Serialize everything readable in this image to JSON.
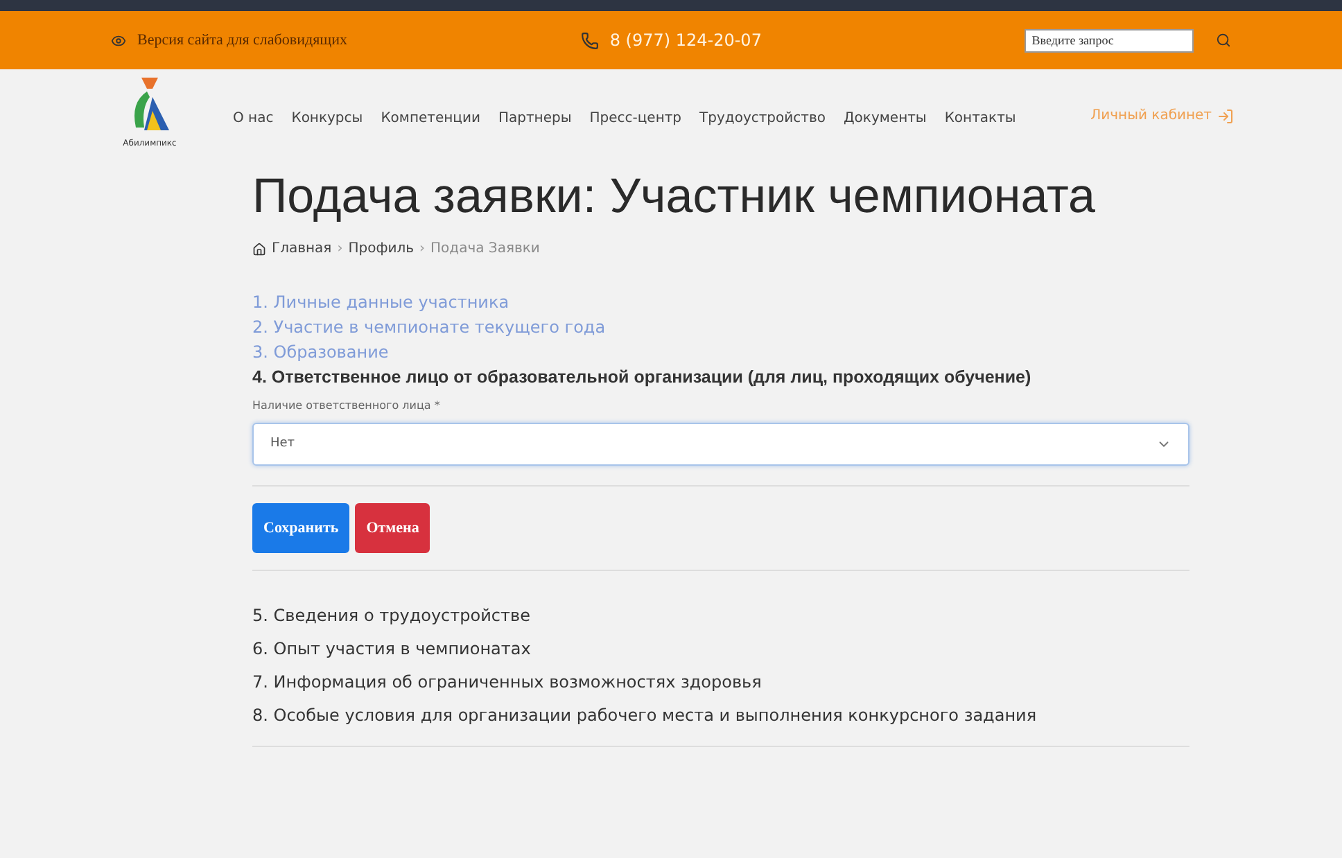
{
  "topbar": {
    "accessibility_link": "Версия сайта для слабовидящих",
    "phone": "8 (977) 124-20-07",
    "search": {
      "placeholder": "Введите запрос"
    }
  },
  "logo": {
    "caption": "Абилимпикс"
  },
  "nav": {
    "items": [
      "О нас",
      "Конкурсы",
      "Компетенции",
      "Партнеры",
      "Пресс-центр",
      "Трудоустройство",
      "Документы",
      "Контакты"
    ],
    "account": "Личный кабинет"
  },
  "title": "Подача заявки: Участник чемпионата",
  "breadcrumb_separator": "›",
  "breadcrumbs": [
    {
      "label": "Главная",
      "current": false
    },
    {
      "label": "Профиль",
      "current": false
    },
    {
      "label": "Подача Заявки",
      "current": true
    }
  ],
  "steps_done": [
    "1. Личные данные участника",
    "2. Участие в чемпионате текущего года",
    "3. Образование"
  ],
  "current_step": {
    "title": "4. Ответственное лицо от образовательной организации (для лиц, проходящих обучение)",
    "field": {
      "label": "Наличие ответственного лица *",
      "value": "Нет"
    },
    "buttons": [
      {
        "label": "Сохранить",
        "kind": "primary"
      },
      {
        "label": "Отмена",
        "kind": "danger"
      }
    ]
  },
  "steps_next": [
    "5. Сведения о трудоустройстве",
    "6. Опыт участия в чемпионатах",
    "7. Информация об ограниченных возможностях здоровья",
    "8. Особые условия для организации рабочего места и выполнения конкурсного задания"
  ]
}
